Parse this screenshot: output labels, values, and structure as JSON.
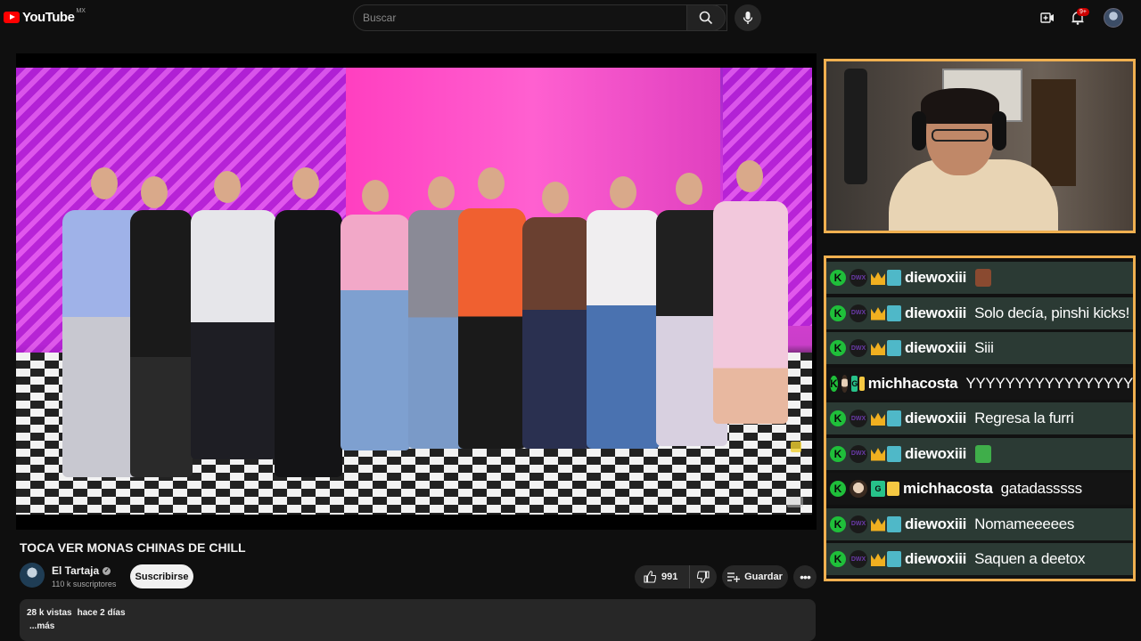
{
  "header": {
    "logo_text": "YouTube",
    "country_code": "MX",
    "search_placeholder": "Buscar",
    "notification_count": "9+"
  },
  "video": {
    "title": "TOCA VER MONAS CHINAS DE CHILL",
    "channel_name": "El Tartaja",
    "subscribers": "110 k suscriptores",
    "subscribe_label": "Suscribirse",
    "likes": "991",
    "save_label": "Guardar",
    "views": "28 k vistas",
    "published": "hace 2 días",
    "more_label": "...más"
  },
  "chat": {
    "messages": [
      {
        "user": "diewoxiii",
        "text": "",
        "emote": "sticker-brown",
        "style": "alt",
        "badges": "dwx"
      },
      {
        "user": "diewoxiii",
        "text": "Solo decía, pinshi kicks!",
        "emote": "",
        "style": "alt",
        "badges": "dwx"
      },
      {
        "user": "diewoxiii",
        "text": "Siii",
        "emote": "",
        "style": "alt",
        "badges": "dwx"
      },
      {
        "user": "michhacosta",
        "text": "YYYYYYYYYYYYYYYYY",
        "emote": "",
        "style": "dark",
        "badges": "face"
      },
      {
        "user": "diewoxiii",
        "text": "Regresa la furri",
        "emote": "",
        "style": "alt",
        "badges": "dwx"
      },
      {
        "user": "diewoxiii",
        "text": "",
        "emote": "sticker-green",
        "style": "alt",
        "badges": "dwx"
      },
      {
        "user": "michhacosta",
        "text": "gatadasssss",
        "emote": "",
        "style": "dark",
        "badges": "face"
      },
      {
        "user": "diewoxiii",
        "text": "Nomameeeees",
        "emote": "",
        "style": "alt",
        "badges": "dwx"
      },
      {
        "user": "diewoxiii",
        "text": "Saquen a deetox",
        "emote": "",
        "style": "alt",
        "badges": "dwx"
      }
    ]
  },
  "colors": {
    "accent_border": "#f0b050",
    "kick_green": "#1fbf3a",
    "youtube_red": "#ff0000"
  }
}
